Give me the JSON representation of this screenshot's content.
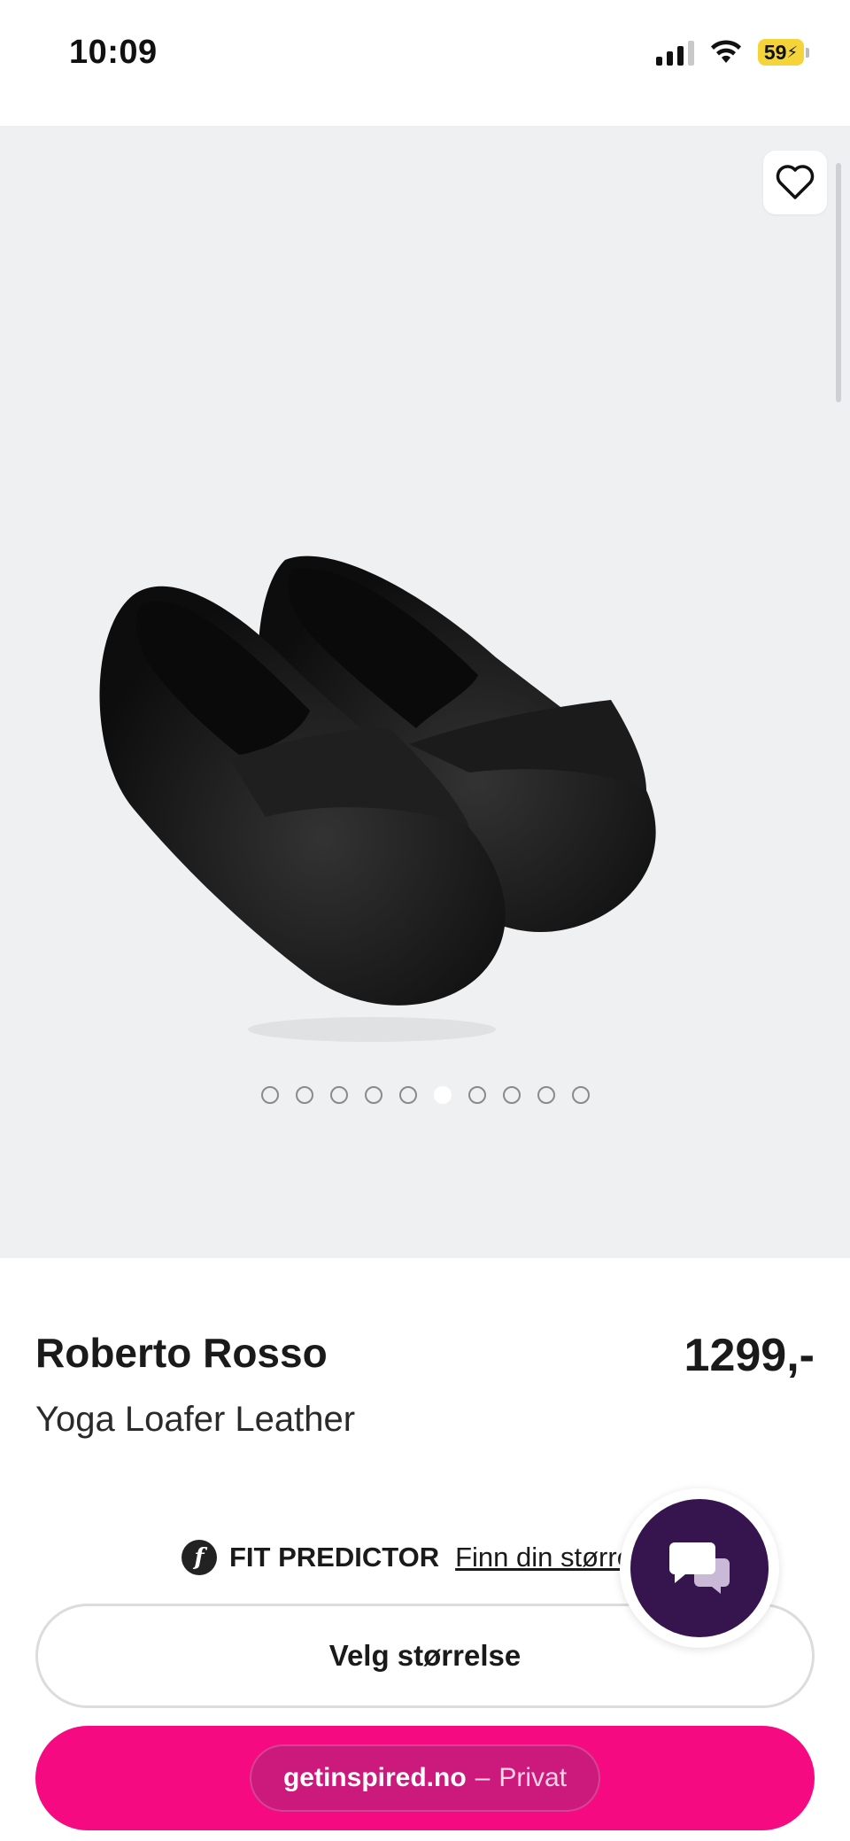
{
  "status_bar": {
    "time": "10:09",
    "battery": "59"
  },
  "gallery": {
    "favorite_icon": "heart-outline-icon",
    "image_alt": "black leather loafers",
    "slide_count": 10,
    "active_slide": 6
  },
  "product": {
    "brand": "Roberto Rosso",
    "price": "1299,-",
    "name": "Yoga Loafer Leather"
  },
  "fit_predictor": {
    "label": "FIT PREDICTOR",
    "link": "Finn din størrelse"
  },
  "buttons": {
    "select_size": "Velg størrelse"
  },
  "browser_bar": {
    "domain": "getinspired.no",
    "separator": "–",
    "mode": "Privat"
  },
  "colors": {
    "accent": "#f50a82",
    "chat": "#36154f",
    "background": "#eff0f2"
  },
  "chat_icon": "chat-bubbles-icon"
}
